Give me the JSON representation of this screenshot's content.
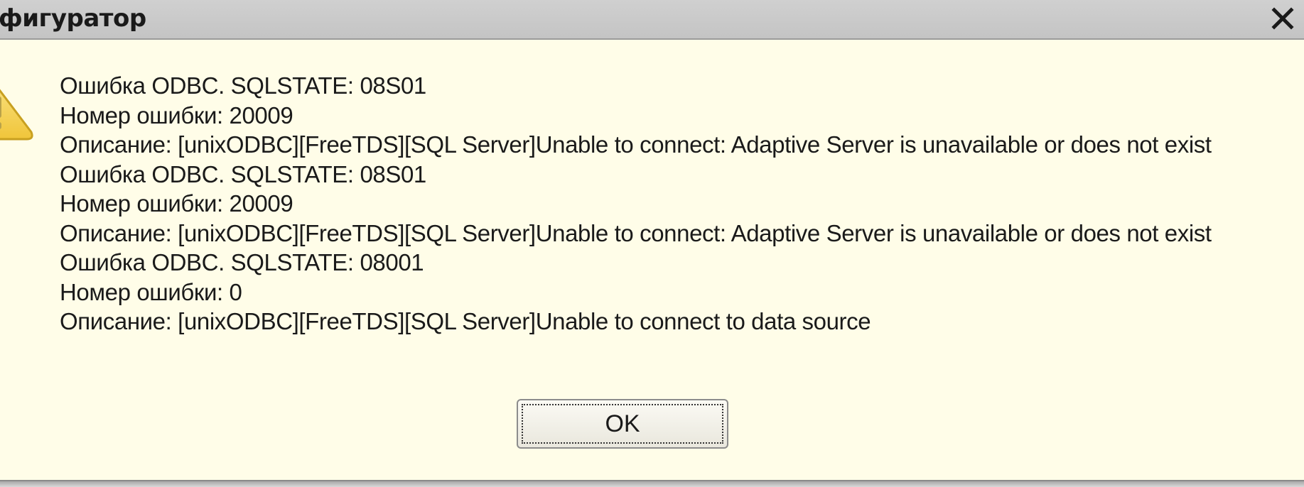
{
  "window": {
    "title": "фигуратор",
    "close_icon": "close-icon"
  },
  "icon": {
    "type": "warning-icon",
    "color": "#f5d25a"
  },
  "message": {
    "lines": [
      "Ошибка ODBC. SQLSTATE: 08S01",
      "Номер ошибки: 20009",
      "Описание: [unixODBC][FreeTDS][SQL Server]Unable to connect: Adaptive Server is unavailable or does not exist",
      "Ошибка ODBC. SQLSTATE: 08S01",
      "Номер ошибки: 20009",
      "Описание: [unixODBC][FreeTDS][SQL Server]Unable to connect: Adaptive Server is unavailable or does not exist",
      "Ошибка ODBC. SQLSTATE: 08001",
      "Номер ошибки: 0",
      "Описание: [unixODBC][FreeTDS][SQL Server]Unable to connect to data source"
    ]
  },
  "buttons": {
    "ok_label": "OK"
  },
  "colors": {
    "background": "#fffde8",
    "titlebar": "#c8c8c8"
  }
}
